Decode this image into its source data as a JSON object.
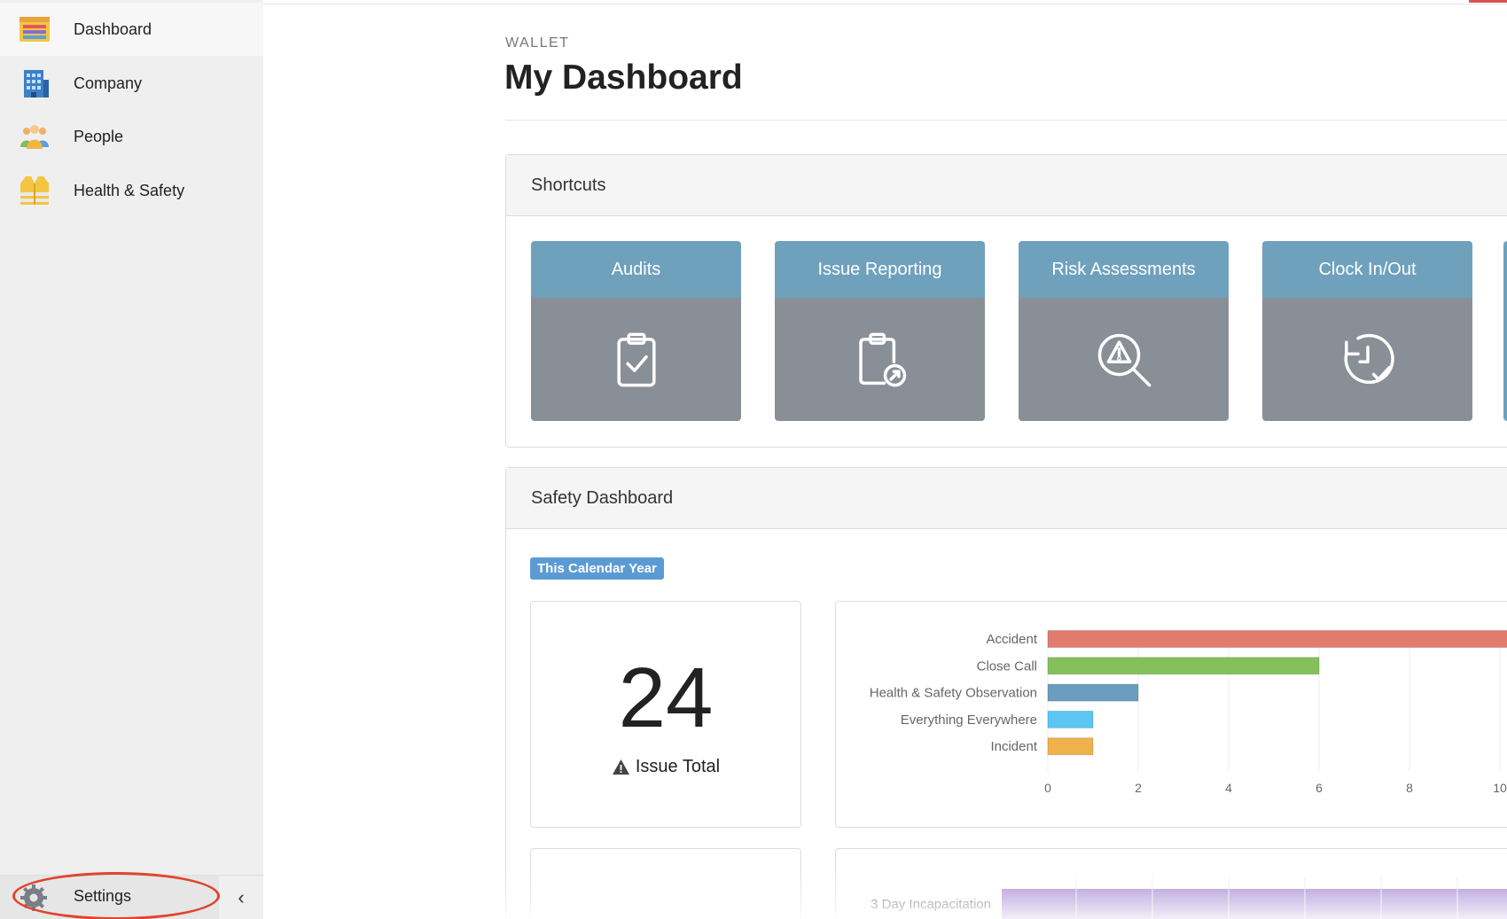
{
  "sidebar": {
    "items": [
      {
        "label": "Dashboard",
        "icon": "dashboard-icon"
      },
      {
        "label": "Company",
        "icon": "building-icon"
      },
      {
        "label": "People",
        "icon": "people-icon"
      },
      {
        "label": "Health & Safety",
        "icon": "safety-vest-icon"
      }
    ],
    "settings_label": "Settings",
    "collapse_icon": "‹"
  },
  "header": {
    "eyebrow": "WALLET",
    "title": "My Dashboard"
  },
  "shortcuts": {
    "title": "Shortcuts",
    "tiles": [
      {
        "label": "Audits",
        "icon": "clipboard-check-icon"
      },
      {
        "label": "Issue Reporting",
        "icon": "clipboard-report-icon"
      },
      {
        "label": "Risk Assessments",
        "icon": "search-warning-icon"
      },
      {
        "label": "Clock In/Out",
        "icon": "clock-check-icon"
      }
    ]
  },
  "safety": {
    "title": "Safety Dashboard",
    "period_badge": "This Calendar Year",
    "issue_total_value": "24",
    "issue_total_label": "Issue Total"
  },
  "colors": {
    "tile_header": "#6fa1bd",
    "tile_body": "#898f96",
    "badge": "#5b9bd5",
    "highlight": "#e0442f"
  },
  "chart_data": [
    {
      "type": "bar",
      "orientation": "horizontal",
      "categories": [
        "Accident",
        "Close Call",
        "Health & Safety Observation",
        "Everything Everywhere",
        "Incident"
      ],
      "values": [
        11,
        6,
        2,
        1,
        1
      ],
      "colors": [
        "#e07b6e",
        "#86c05a",
        "#6b9dbf",
        "#5bc6f4",
        "#f0b24a"
      ],
      "xticks": [
        "0",
        "2",
        "4",
        "6",
        "8",
        "10"
      ],
      "xlim": [
        0,
        10
      ],
      "grid": true
    },
    {
      "type": "bar",
      "orientation": "horizontal",
      "categories": [
        "3 Day Incapacitation"
      ],
      "values": [
        null
      ],
      "colors": [
        "#ab8fd6"
      ]
    }
  ]
}
